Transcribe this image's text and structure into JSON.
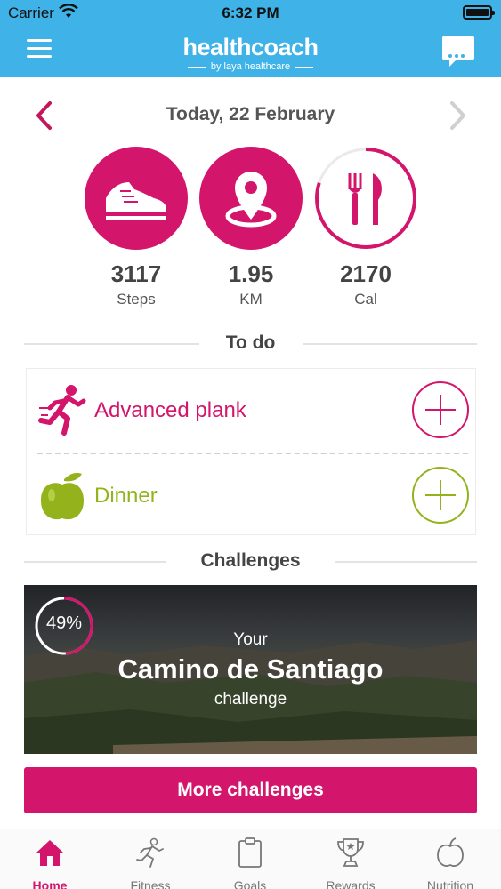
{
  "status_bar": {
    "carrier": "Carrier",
    "time": "6:32 PM"
  },
  "header": {
    "logo": "healthcoach",
    "tagline": "by laya healthcare"
  },
  "date_nav": {
    "title": "Today, 22 February"
  },
  "stats": [
    {
      "value": "3117",
      "unit": "Steps",
      "icon": "shoe-icon"
    },
    {
      "value": "1.95",
      "unit": "KM",
      "icon": "location-pin-icon"
    },
    {
      "value": "2170",
      "unit": "Cal",
      "icon": "fork-knife-icon",
      "progress": 0.8
    }
  ],
  "todo": {
    "heading": "To do",
    "items": [
      {
        "label": "Advanced plank",
        "color": "#d3156b",
        "icon": "running-figure-icon"
      },
      {
        "label": "Dinner",
        "color": "#93b21c",
        "icon": "apple-icon"
      }
    ]
  },
  "challenges": {
    "heading": "Challenges",
    "banner": {
      "progress_text": "49%",
      "progress": 0.49,
      "line1": "Your",
      "line2": "Camino de Santiago",
      "line3": "challenge"
    },
    "more_button": "More challenges"
  },
  "tabs": [
    {
      "label": "Home",
      "active": true,
      "icon": "home-icon"
    },
    {
      "label": "Fitness",
      "active": false,
      "icon": "fitness-figure-icon"
    },
    {
      "label": "Goals",
      "active": false,
      "icon": "clipboard-icon"
    },
    {
      "label": "Rewards",
      "active": false,
      "icon": "trophy-icon"
    },
    {
      "label": "Nutrition",
      "active": false,
      "icon": "apple-outline-icon"
    }
  ],
  "colors": {
    "brand_blue": "#3fb2e8",
    "accent_pink": "#d3156b",
    "accent_green": "#93b21c"
  }
}
